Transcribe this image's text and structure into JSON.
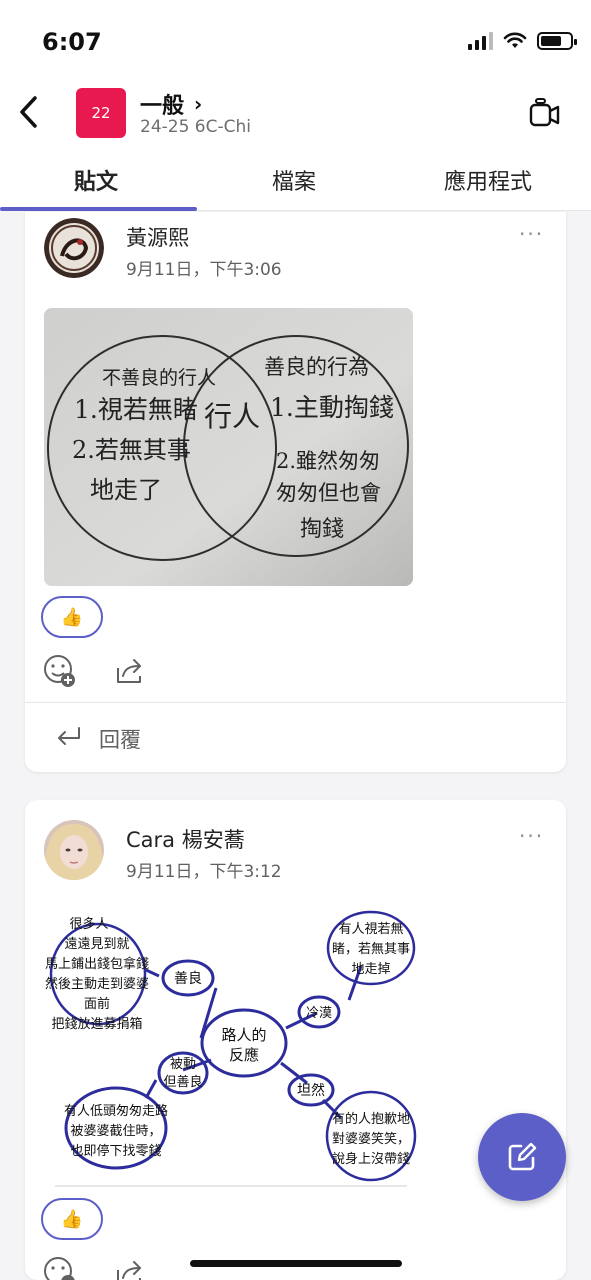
{
  "status_bar": {
    "time": "6:07"
  },
  "header": {
    "team_badge": "22",
    "channel_name": "一般",
    "team_name": "24-25 6C-Chi"
  },
  "tabs": [
    {
      "label": "貼文",
      "active": true
    },
    {
      "label": "檔案",
      "active": false
    },
    {
      "label": "應用程式",
      "active": false
    }
  ],
  "posts": [
    {
      "author": "黃源熙",
      "timestamp": "9月11日，下午3:06",
      "image": {
        "left_circle": [
          "不善良的行人",
          "1.視若無睹",
          "2.若無其事",
          "地走了"
        ],
        "center": "行人",
        "right_circle": [
          "善良的行為",
          "1.主動掏錢",
          "2.雖然匆匆",
          "匆匆但也會",
          "掏錢"
        ]
      },
      "reaction": "👍",
      "reply_label": "回覆"
    },
    {
      "author": "Cara 楊安蕎",
      "timestamp": "9月11日，下午3:12",
      "mindmap": {
        "center": [
          "路人的",
          "反應"
        ],
        "kind": "善良",
        "kind_detail": [
          "很多人",
          "遠遠見到就",
          "馬上鋪出錢包拿錢",
          "然後主動走到婆婆",
          "面前",
          "把錢放進募捐箱"
        ],
        "cold": "冷漠",
        "cold_detail": [
          "有人視若無",
          "睹，若無其事",
          "地走掉"
        ],
        "passive": [
          "被動",
          "但善良"
        ],
        "passive_detail": [
          "有人低頭匆匆走路",
          "被婆婆截住時，",
          "也即停下找零錢"
        ],
        "calm": "坦然",
        "calm_detail": [
          "有的人抱歉地",
          "對婆婆笑笑，",
          "說身上沒帶錢"
        ]
      },
      "reaction": "👍"
    }
  ],
  "colors": {
    "accent": "#5b5fc7",
    "team_badge": "#e8194f"
  }
}
